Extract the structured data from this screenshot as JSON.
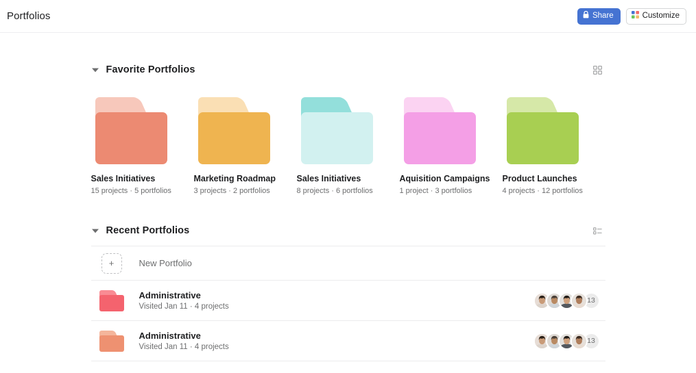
{
  "header": {
    "title": "Portfolios",
    "share_label": "Share",
    "customize_label": "Customize"
  },
  "favorites": {
    "title": "Favorite Portfolios",
    "view_icon": "grid-view-icon",
    "cards": [
      {
        "name": "Sales Initiatives",
        "meta": "15 projects · 5 portfolios",
        "tab": "#F7C8BB",
        "body": "#EC8A72"
      },
      {
        "name": "Marketing Roadmap",
        "meta": "3 projects · 2 portfolios",
        "tab": "#FADFB4",
        "body": "#EFB450"
      },
      {
        "name": "Sales Initiatives",
        "meta": "8 projects · 6 portfolios",
        "tab": "#93DFDB",
        "body": "#D2F1F0"
      },
      {
        "name": "Aquisition Campaigns",
        "meta": "1 project · 3 portfolios",
        "tab": "#FBD3F2",
        "body": "#F49FE6"
      },
      {
        "name": "Product Launches",
        "meta": "4 projects · 12 portfolios",
        "tab": "#D6E8A8",
        "body": "#A8CF52"
      }
    ]
  },
  "recent": {
    "title": "Recent Portfolios",
    "view_icon": "list-view-icon",
    "new_portfolio_label": "New Portfolio",
    "new_portfolio_plus": "+",
    "rows": [
      {
        "name": "Administrative",
        "meta": "Visited Jan 11 · 4 projects",
        "tab": "#F98B93",
        "body": "#F4636E",
        "avatar_count": "13"
      },
      {
        "name": "Administrative",
        "meta": "Visited Jan 11 · 4 projects",
        "tab": "#F4B59B",
        "body": "#EE9171",
        "avatar_count": "13"
      }
    ]
  },
  "colors": {
    "accent": "#4573d2",
    "text": "#1e1f21",
    "muted": "#6d6e6f"
  }
}
